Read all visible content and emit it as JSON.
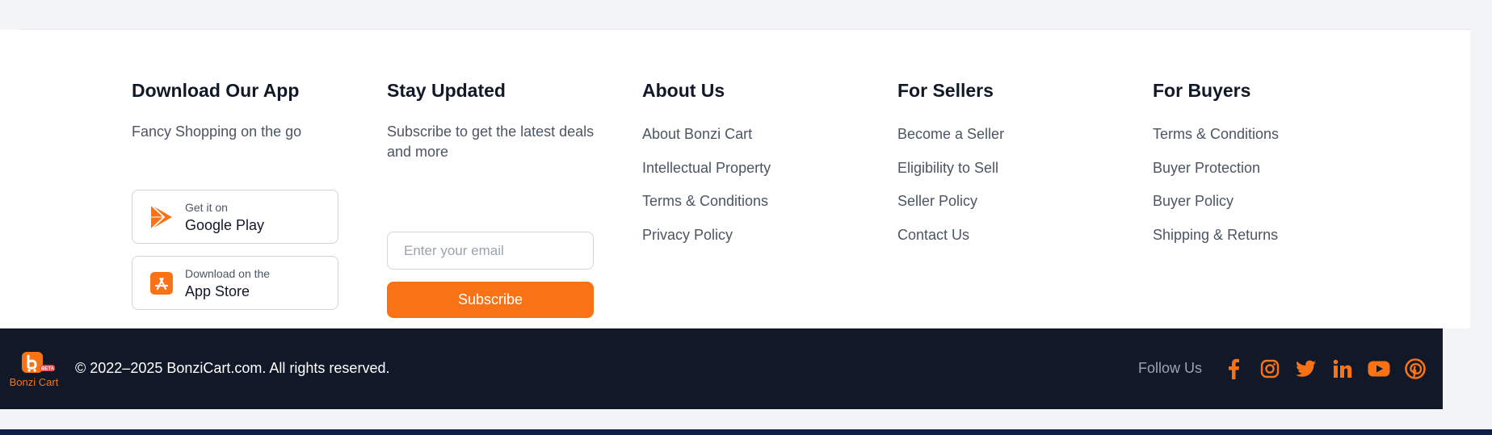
{
  "colors": {
    "accent": "#f97316",
    "footer_bg": "#111827",
    "text_muted": "#4b5563"
  },
  "download": {
    "title": "Download Our App",
    "subtitle": "Fancy Shopping on the go",
    "google_play": {
      "small": "Get it on",
      "big": "Google Play",
      "icon": "google-play-icon"
    },
    "app_store": {
      "small": "Download on the",
      "big": "App Store",
      "icon": "app-store-icon"
    }
  },
  "updates": {
    "title": "Stay Updated",
    "subtitle": "Subscribe to get the latest deals and more",
    "email_placeholder": "Enter your email",
    "email_value": "",
    "subscribe_label": "Subscribe"
  },
  "about": {
    "title": "About Us",
    "links": [
      "About Bonzi Cart",
      "Intellectual Property",
      "Terms & Conditions",
      "Privacy Policy"
    ]
  },
  "sellers": {
    "title": "For Sellers",
    "links": [
      "Become a Seller",
      "Eligibility to Sell",
      "Seller Policy",
      "Contact Us"
    ]
  },
  "buyers": {
    "title": "For Buyers",
    "links": [
      "Terms & Conditions",
      "Buyer Protection",
      "Buyer Policy",
      "Shipping & Returns"
    ]
  },
  "footer": {
    "logo_text": "Bonzi Cart",
    "logo_badge": "BETA",
    "copyright": "© 2022–2025 BonziCart.com. All rights reserved.",
    "follow_label": "Follow Us",
    "socials": [
      "facebook-icon",
      "instagram-icon",
      "twitter-icon",
      "linkedin-icon",
      "youtube-icon",
      "pinterest-icon"
    ]
  }
}
